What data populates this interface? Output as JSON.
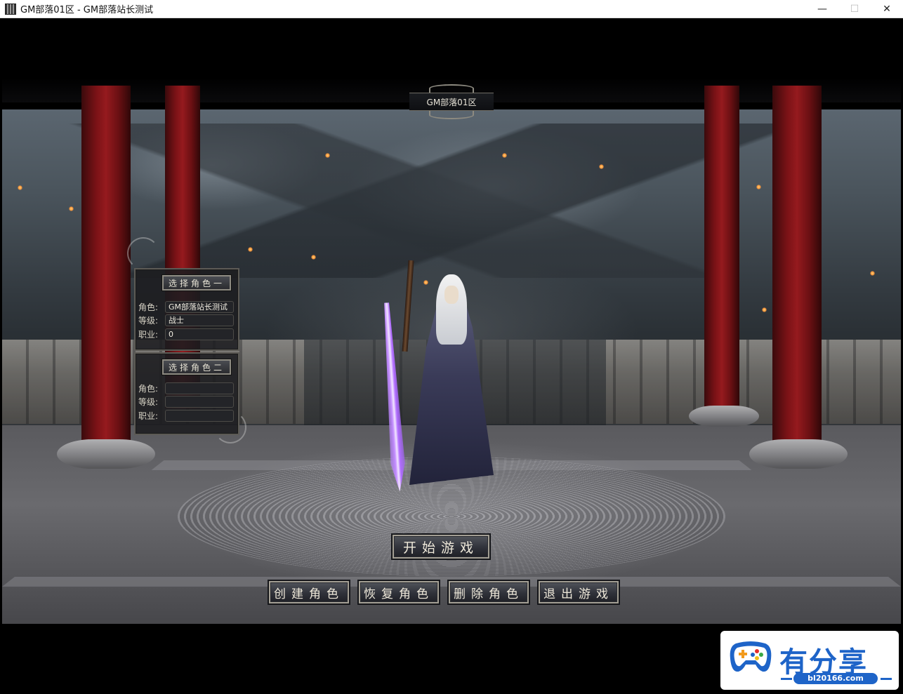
{
  "window": {
    "title": "GM部落01区 - GM部落站长测试",
    "buttons": {
      "minimize": "—",
      "maximize": "☐",
      "close": "✕"
    }
  },
  "server": {
    "name": "GM部落01区"
  },
  "roles": [
    {
      "header": "选择角色一",
      "labels": {
        "name": "角色:",
        "level": "等级:",
        "class": "职业:"
      },
      "values": {
        "name": "GM部落站长测试",
        "level": "战士",
        "class": "0"
      }
    },
    {
      "header": "选择角色二",
      "labels": {
        "name": "角色:",
        "level": "等级:",
        "class": "职业:"
      },
      "values": {
        "name": "",
        "level": "",
        "class": ""
      }
    }
  ],
  "buttons": {
    "start": "开始游戏",
    "create": "创建角色",
    "restore": "恢复角色",
    "delete": "删除角色",
    "exit": "退出游戏"
  },
  "watermark": {
    "brand": "有分享",
    "url": "bl20166.com"
  },
  "colors": {
    "pillar": "#951a1e",
    "sword_glow": "#b06cff",
    "watermark_blue": "#1e64c8"
  }
}
